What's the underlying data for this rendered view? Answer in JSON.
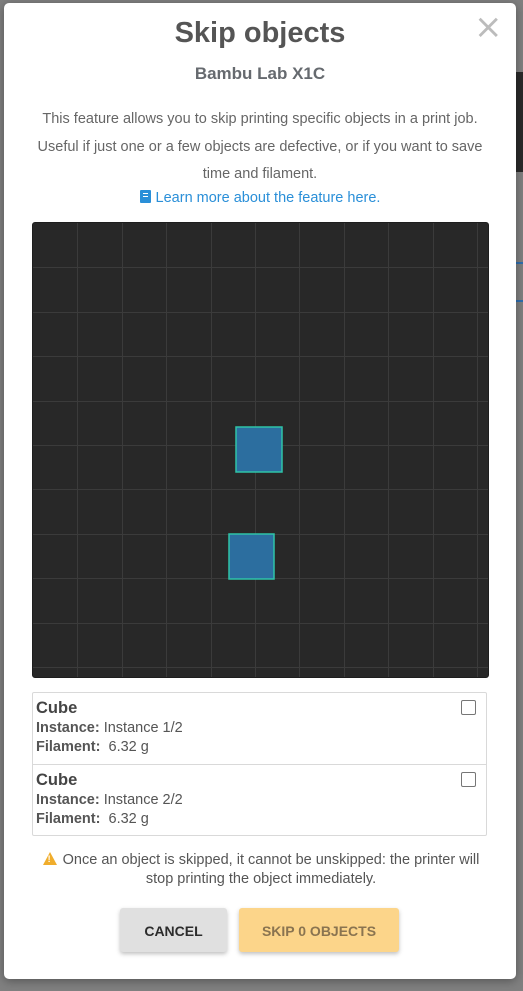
{
  "dialog": {
    "title": "Skip objects",
    "printer_name": "Bambu Lab X1C",
    "close_glyph": "×",
    "description": "This feature allows you to skip printing specific objects in a print job. Useful if just one or a few objects are defective, or if you want to save time and filament.",
    "learn_more_label": "Learn more about the feature here.",
    "learn_more_icon": "book-icon"
  },
  "plate": {
    "background": "#282828",
    "grid_color": "#3b3b3b",
    "object_fill": "#2c6e9f",
    "object_stroke": "#2ec4a8"
  },
  "objects": [
    {
      "name": "Cube",
      "instance_label": "Instance:",
      "instance_value": "Instance 1/2",
      "filament_label": "Filament:",
      "filament_value": "6.32 g",
      "checked": false
    },
    {
      "name": "Cube",
      "instance_label": "Instance:",
      "instance_value": "Instance 2/2",
      "filament_label": "Filament:",
      "filament_value": "6.32 g",
      "checked": false
    }
  ],
  "warning": {
    "icon": "warning-icon",
    "text": "Once an object is skipped, it cannot be unskipped: the printer will stop printing the object immediately."
  },
  "buttons": {
    "cancel_label": "CANCEL",
    "skip_label": "SKIP 0 OBJECTS"
  },
  "colors": {
    "link": "#2a8fd8",
    "skip_button": "#fcd58a",
    "cancel_button": "#e0e0e0"
  }
}
